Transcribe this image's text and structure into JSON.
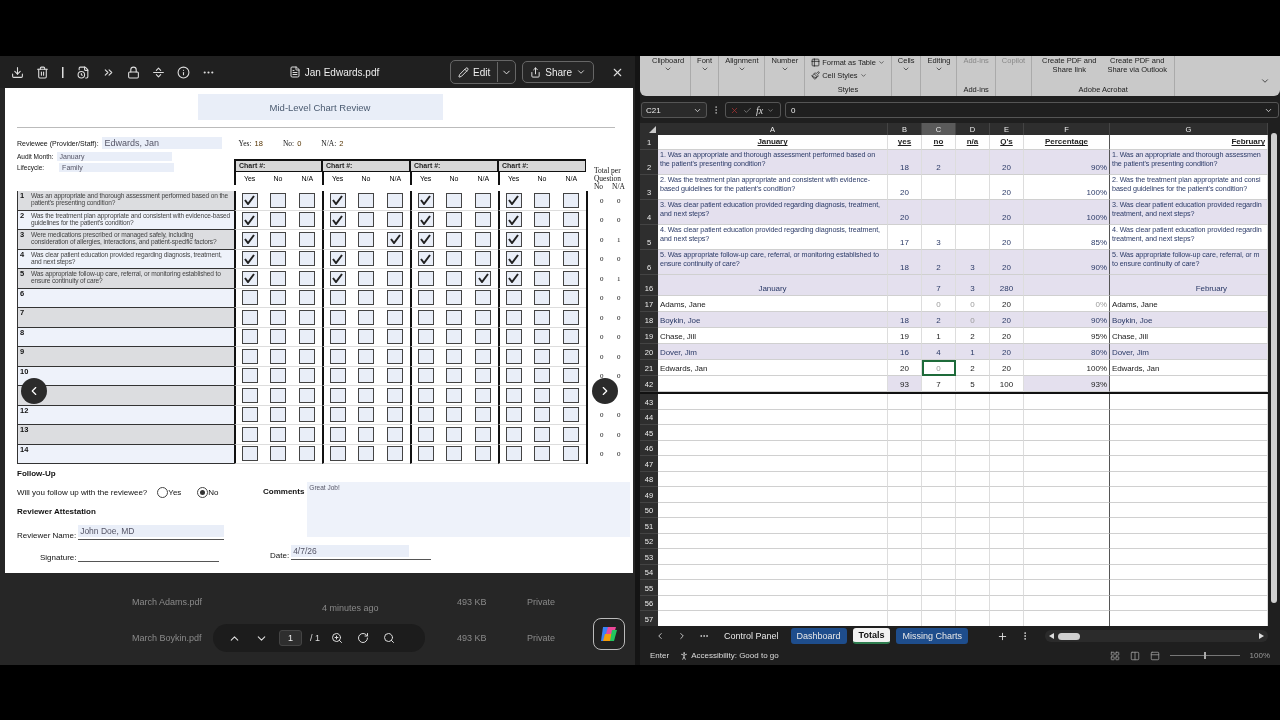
{
  "pdf_viewer": {
    "file_name": "Jan Edwards.pdf",
    "edit_label": "Edit",
    "share_label": "Share",
    "form": {
      "title": "Mid-Level Chart Review",
      "reviewee_label": "Reviewee (Provider/Staff):",
      "reviewee": "Edwards, Jan",
      "counts": [
        {
          "label": "Yes:",
          "value": "18"
        },
        {
          "label": "No:",
          "value": "0"
        },
        {
          "label": "N/A:",
          "value": "2"
        }
      ],
      "audit_month_label": "Audit Month:",
      "audit_month": "January",
      "lifecycle_label": "Lifecycle:",
      "lifecycle": "Family",
      "charts": [
        {
          "title": "Chart #:",
          "answers": [
            "Yes",
            "No",
            "N/A"
          ]
        },
        {
          "title": "Chart #:",
          "answers": [
            "Yes",
            "No",
            "N/A"
          ]
        },
        {
          "title": "Chart #:",
          "answers": [
            "Yes",
            "No",
            "N/A"
          ]
        },
        {
          "title": "Chart #:",
          "answers": [
            "Yes",
            "No",
            "N/A"
          ]
        }
      ],
      "totals_header": "Total per Question",
      "totals_columns": [
        "No",
        "N/A"
      ],
      "questions": [
        {
          "number": "1",
          "text": "Was an appropriate and thorough assessment performed based on the patient's presenting condition?",
          "checks": [
            [
              true,
              false,
              false
            ],
            [
              true,
              false,
              false
            ],
            [
              true,
              false,
              false
            ],
            [
              true,
              false,
              false
            ]
          ],
          "totals": {
            "no": "0",
            "na": "0"
          }
        },
        {
          "number": "2",
          "text": "Was the treatment plan appropriate and consistent with evidence-based guidelines for the patient's condition?",
          "checks": [
            [
              true,
              false,
              false
            ],
            [
              true,
              false,
              false
            ],
            [
              true,
              false,
              false
            ],
            [
              true,
              false,
              false
            ]
          ],
          "totals": {
            "no": "0",
            "na": "0"
          }
        },
        {
          "number": "3",
          "text": "Were medications prescribed or managed safely, including consideration of allergies, interactions, and patient-specific factors?",
          "checks": [
            [
              true,
              false,
              false
            ],
            [
              false,
              false,
              true
            ],
            [
              true,
              false,
              false
            ],
            [
              true,
              false,
              false
            ]
          ],
          "totals": {
            "no": "0",
            "na": "1"
          }
        },
        {
          "number": "4",
          "text": "Was clear patient education provided regarding diagnosis, treatment, and next steps?",
          "checks": [
            [
              true,
              false,
              false
            ],
            [
              true,
              false,
              false
            ],
            [
              true,
              false,
              false
            ],
            [
              true,
              false,
              false
            ]
          ],
          "totals": {
            "no": "0",
            "na": "0"
          }
        },
        {
          "number": "5",
          "text": "Was appropriate follow-up care, referral, or monitoring established to ensure continuity of care?",
          "checks": [
            [
              true,
              false,
              false
            ],
            [
              true,
              false,
              false
            ],
            [
              false,
              false,
              true
            ],
            [
              true,
              false,
              false
            ]
          ],
          "totals": {
            "no": "0",
            "na": "1"
          }
        },
        {
          "number": "6",
          "checks": [
            [
              false,
              false,
              false
            ],
            [
              false,
              false,
              false
            ],
            [
              false,
              false,
              false
            ],
            [
              false,
              false,
              false
            ]
          ],
          "totals": {
            "no": "0",
            "na": "0"
          }
        },
        {
          "number": "7",
          "checks": [
            [
              false,
              false,
              false
            ],
            [
              false,
              false,
              false
            ],
            [
              false,
              false,
              false
            ],
            [
              false,
              false,
              false
            ]
          ],
          "totals": {
            "no": "0",
            "na": "0"
          }
        },
        {
          "number": "8",
          "checks": [
            [
              false,
              false,
              false
            ],
            [
              false,
              false,
              false
            ],
            [
              false,
              false,
              false
            ],
            [
              false,
              false,
              false
            ]
          ],
          "totals": {
            "no": "0",
            "na": "0"
          }
        },
        {
          "number": "9",
          "checks": [
            [
              false,
              false,
              false
            ],
            [
              false,
              false,
              false
            ],
            [
              false,
              false,
              false
            ],
            [
              false,
              false,
              false
            ]
          ],
          "totals": {
            "no": "0",
            "na": "0"
          }
        },
        {
          "number": "10",
          "checks": [
            [
              false,
              false,
              false
            ],
            [
              false,
              false,
              false
            ],
            [
              false,
              false,
              false
            ],
            [
              false,
              false,
              false
            ]
          ],
          "totals": {
            "no": "0",
            "na": "0"
          }
        },
        {
          "checks": [
            [
              false,
              false,
              false
            ],
            [
              false,
              false,
              false
            ],
            [
              false,
              false,
              false
            ],
            [
              false,
              false,
              false
            ]
          ]
        },
        {
          "number": "12",
          "checks": [
            [
              false,
              false,
              false
            ],
            [
              false,
              false,
              false
            ],
            [
              false,
              false,
              false
            ],
            [
              false,
              false,
              false
            ]
          ],
          "totals": {
            "no": "0",
            "na": "0"
          }
        },
        {
          "number": "13",
          "checks": [
            [
              false,
              false,
              false
            ],
            [
              false,
              false,
              false
            ],
            [
              false,
              false,
              false
            ],
            [
              false,
              false,
              false
            ]
          ],
          "totals": {
            "no": "0",
            "na": "0"
          }
        },
        {
          "number": "14",
          "checks": [
            [
              false,
              false,
              false
            ],
            [
              false,
              false,
              false
            ],
            [
              false,
              false,
              false
            ],
            [
              false,
              false,
              false
            ]
          ],
          "totals": {
            "no": "0",
            "na": "0"
          }
        }
      ],
      "follow_up_heading": "Follow-Up",
      "follow_up_question": "Will you follow up with the reviewee?",
      "follow_up_options": [
        {
          "label": "Yes",
          "selected": false
        },
        {
          "label": "No",
          "selected": true
        }
      ],
      "comments_label": "Comments",
      "comments": "Great Job!",
      "attestation_heading": "Reviewer Attestation",
      "reviewer_name_label": "Reviewer Name:",
      "reviewer_name": "John Doe, MD",
      "signature_label": "Signature:",
      "date_label": "Date:",
      "date": "4/7/26"
    },
    "background_files": [
      {
        "name": "March Adams.pdf",
        "modified": "4 minutes ago",
        "size": "493 KB",
        "access": "Private"
      },
      {
        "name": "March Boykin.pdf",
        "size": "493 KB",
        "access": "Private"
      }
    ],
    "page_nav": {
      "page": "1",
      "total": "/ 1"
    }
  },
  "excel": {
    "ribbon": [
      {
        "commands": [
          {
            "label": "Clipboard",
            "kind": "dropdown",
            "disabled": false
          }
        ]
      },
      {
        "commands": [
          {
            "label": "Font",
            "kind": "dropdown",
            "disabled": false
          }
        ]
      },
      {
        "commands": [
          {
            "label": "Alignment",
            "kind": "dropdown",
            "disabled": false
          }
        ]
      },
      {
        "commands": [
          {
            "label": "Number",
            "kind": "dropdown",
            "disabled": false
          }
        ]
      },
      {
        "commands": [
          {
            "label": "Format as Table",
            "kind": "small",
            "disabled": false
          },
          {
            "label": "Cell Styles",
            "kind": "small",
            "disabled": false
          }
        ],
        "label": "Styles"
      },
      {
        "commands": [
          {
            "label": "Cells",
            "kind": "dropdown",
            "disabled": false
          }
        ]
      },
      {
        "commands": [
          {
            "label": "Editing",
            "kind": "dropdown",
            "disabled": false
          }
        ]
      },
      {
        "commands": [
          {
            "label": "Add-ins",
            "kind": "plain",
            "disabled": true
          }
        ],
        "label": "Add-ins"
      },
      {
        "commands": [
          {
            "label": "Copilot",
            "kind": "plain",
            "disabled": true
          }
        ]
      },
      {
        "commands": [
          {
            "label": "Create PDF and Share link",
            "kind": "plain",
            "disabled": false
          },
          {
            "label": "Create PDF and Share via Outlook",
            "kind": "plain",
            "disabled": false
          }
        ],
        "label": "Adobe Acrobat"
      }
    ],
    "name_box": "C21",
    "function_label": "fx",
    "formula": "0",
    "columns": [
      {
        "label": "A",
        "selected": false
      },
      {
        "label": "B",
        "selected": false
      },
      {
        "label": "C",
        "selected": true
      },
      {
        "label": "D",
        "selected": false
      },
      {
        "label": "E",
        "selected": false
      },
      {
        "label": "F",
        "selected": false
      },
      {
        "label": "G",
        "selected": false
      }
    ],
    "rows": [
      {
        "row": "1",
        "kind": "header",
        "banded": false,
        "cells": [
          "January",
          "yes",
          "no",
          "n/a",
          "Q's",
          "Percentage",
          "February"
        ]
      },
      {
        "row": "2",
        "kind": "question",
        "banded": true,
        "cells": [
          "1. Was an appropriate and thorough assessment performed based on the patient's presenting condition?",
          "18",
          "2",
          null,
          "20",
          "90%",
          "1. Was an appropriate and thorough assessmen\nthe patient's presenting condition?"
        ]
      },
      {
        "row": "3",
        "kind": "question",
        "banded": false,
        "cells": [
          "2. Was the treatment plan appropriate and consistent with evidence-based guidelines for the patient's condition?",
          "20",
          null,
          null,
          "20",
          "100%",
          "2. Was the treatment plan appropriate and consi\nbased guidelines for the patient's condition?"
        ]
      },
      {
        "row": "4",
        "kind": "question",
        "banded": true,
        "cells": [
          "3. Was clear patient education provided regarding diagnosis, treatment, and next steps?",
          "20",
          null,
          null,
          "20",
          "100%",
          "3. Was clear patient education provided regardin\ntreatment, and next steps?"
        ]
      },
      {
        "row": "5",
        "kind": "question",
        "banded": false,
        "cells": [
          "4. Was clear patient education provided regarding diagnosis, treatment, and next steps?",
          "17",
          "3",
          null,
          "20",
          "85%",
          "4. Was clear patient education provided regardin\ntreatment, and next steps?"
        ]
      },
      {
        "row": "6",
        "kind": "question",
        "banded": true,
        "cells": [
          "5. Was appropriate follow-up care, referral, or monitoring established to ensure continuity of care?",
          "18",
          "2",
          "3",
          "20",
          "90%",
          "5. Was appropriate follow-up care, referral, or m\nto ensure continuity of care?"
        ]
      },
      {
        "row": "16",
        "kind": "section",
        "banded": true,
        "cells": [
          "January",
          null,
          "7",
          "3",
          "280",
          null,
          "February"
        ]
      },
      {
        "row": "17",
        "kind": "person",
        "banded": false,
        "cells": [
          "Adams, Jane",
          null,
          {
            "text": "0",
            "faint": true
          },
          {
            "text": "0",
            "faint": true
          },
          "20",
          {
            "text": "0%",
            "faint": true
          },
          "Adams, Jane"
        ]
      },
      {
        "row": "18",
        "kind": "person",
        "banded": true,
        "cells": [
          "Boykin, Joe",
          "18",
          "2",
          {
            "text": "0",
            "faint": true
          },
          "20",
          "90%",
          "Boykin, Joe"
        ]
      },
      {
        "row": "19",
        "kind": "person",
        "banded": false,
        "cells": [
          "Chase, Jill",
          "19",
          "1",
          "2",
          "20",
          "95%",
          "Chase, Jill"
        ]
      },
      {
        "row": "20",
        "kind": "person",
        "banded": true,
        "cells": [
          "Dover, Jim",
          "16",
          "4",
          "1",
          "20",
          "80%",
          "Dover, Jim"
        ]
      },
      {
        "row": "21",
        "kind": "person",
        "banded": false,
        "cells": [
          "Edwards, Jan",
          "20",
          {
            "text": "0",
            "faint": true,
            "selected": true
          },
          "2",
          "20",
          "100%",
          "Edwards, Jan"
        ]
      },
      {
        "row": "42",
        "kind": "total",
        "banded": false,
        "cells": [
          null,
          "93",
          "7",
          "5",
          "100",
          "93%",
          null
        ]
      }
    ],
    "empty_rows": [
      "43",
      "44",
      "45",
      "46",
      "47",
      "48",
      "49",
      "50",
      "51",
      "52",
      "53",
      "54",
      "55",
      "56",
      "57"
    ],
    "sheet_tabs": [
      {
        "label": "Control Panel",
        "selected": false
      },
      {
        "label": "Dashboard",
        "selected": false,
        "color": "#1e4d8c"
      },
      {
        "label": "Totals",
        "selected": true
      },
      {
        "label": "Missing Charts",
        "selected": false,
        "color": "#1e4d8c"
      }
    ],
    "status": {
      "mode": "Enter",
      "accessibility": "Accessibility: Good to go",
      "zoom_slider": {
        "level": 0.5
      },
      "zoom": "100%"
    }
  }
}
